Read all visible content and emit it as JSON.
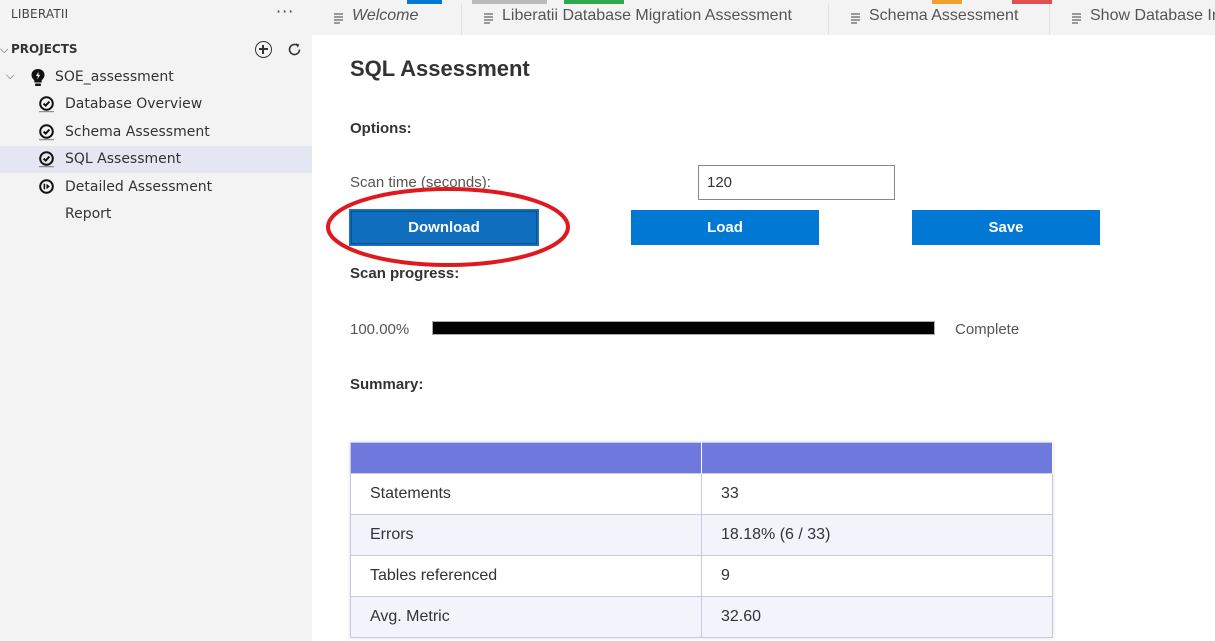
{
  "sidebar": {
    "title": "LIBERATII",
    "more": "···",
    "projects_label": "PROJECTS",
    "project": {
      "name": "SOE_assessment",
      "items": [
        {
          "label": "Database Overview",
          "icon": "check-circle-icon"
        },
        {
          "label": "Schema Assessment",
          "icon": "check-circle-icon"
        },
        {
          "label": "SQL Assessment",
          "icon": "check-circle-icon",
          "selected": true
        },
        {
          "label": "Detailed Assessment",
          "icon": "play-circle-icon"
        },
        {
          "label": "Report",
          "icon": null
        }
      ]
    }
  },
  "tabs": [
    {
      "label": "Welcome"
    },
    {
      "label": "Liberatii Database Migration Assessment"
    },
    {
      "label": "Schema Assessment"
    },
    {
      "label": "Show Database Info"
    }
  ],
  "main": {
    "title": "SQL Assessment",
    "options_label": "Options:",
    "scan_time_label": "Scan time (seconds):",
    "scan_time_value": "120",
    "buttons": {
      "download": "Download",
      "load": "Load",
      "save": "Save"
    },
    "scan_progress_label": "Scan progress:",
    "progress": {
      "percent_text": "100.00%",
      "value": 1.0,
      "status": "Complete"
    },
    "summary_label": "Summary:",
    "summary_rows": [
      {
        "label": "Statements",
        "value": "33"
      },
      {
        "label": "Errors",
        "value": "18.18% (6 / 33)"
      },
      {
        "label": "Tables referenced",
        "value": "9"
      },
      {
        "label": "Avg. Metric",
        "value": "32.60"
      }
    ]
  },
  "colors": {
    "accent": "#0078d4",
    "table_header": "#6e78dd",
    "highlight_annotation": "#e0191f",
    "progress_fill": "#000000"
  }
}
